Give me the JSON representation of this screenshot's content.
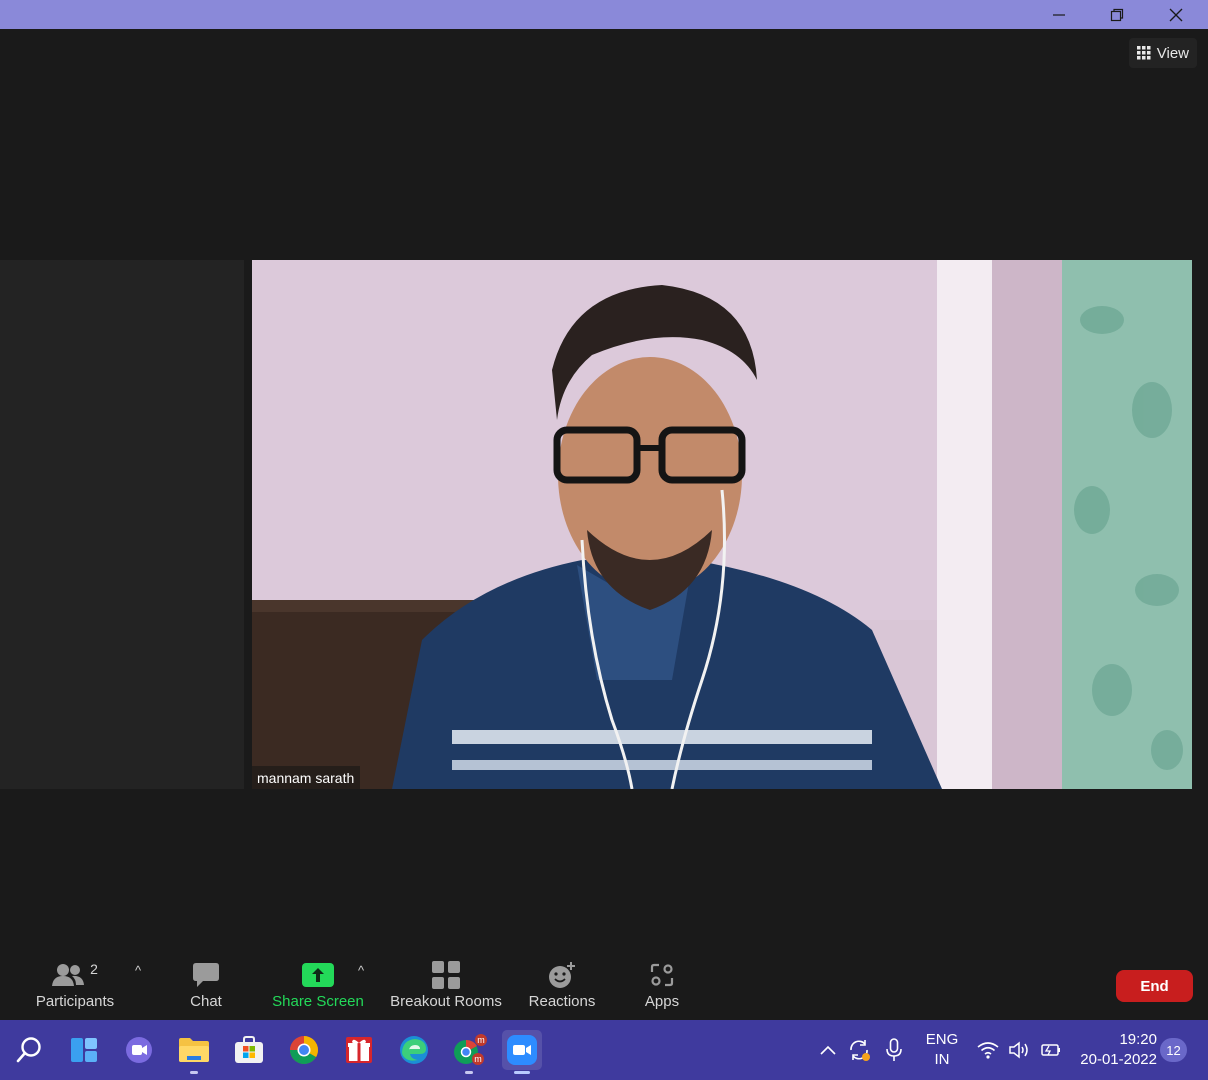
{
  "window": {
    "controls": [
      "minimize-icon",
      "restore-icon",
      "close-icon"
    ],
    "accent_color": "#8a89d9"
  },
  "view": {
    "label": "View",
    "icon": "grid-icon"
  },
  "video": {
    "participant_name": "mannam sarath"
  },
  "toolbar": {
    "participants": {
      "label": "Participants",
      "count": "2",
      "icon": "people-icon"
    },
    "chat": {
      "label": "Chat",
      "icon": "chat-icon"
    },
    "share_screen": {
      "label": "Share Screen",
      "icon": "share-screen-icon",
      "color": "#23d959"
    },
    "breakout_rooms": {
      "label": "Breakout Rooms",
      "icon": "breakout-rooms-icon"
    },
    "reactions": {
      "label": "Reactions",
      "icon": "reactions-icon"
    },
    "apps": {
      "label": "Apps",
      "icon": "apps-icon"
    },
    "end": {
      "label": "End",
      "color": "#c81e1e"
    }
  },
  "taskbar": {
    "apps": [
      "search-icon",
      "widgets-icon",
      "teams-chat-icon",
      "file-explorer-icon",
      "microsoft-store-icon",
      "chrome-icon",
      "gift-icon",
      "edge-icon",
      "chrome-profile-icon",
      "zoom-icon"
    ],
    "tray": {
      "language_top": "ENG",
      "language_bottom": "IN",
      "time": "19:20",
      "date": "20-01-2022",
      "notifications": "12"
    },
    "color": "#3f3a9e"
  }
}
